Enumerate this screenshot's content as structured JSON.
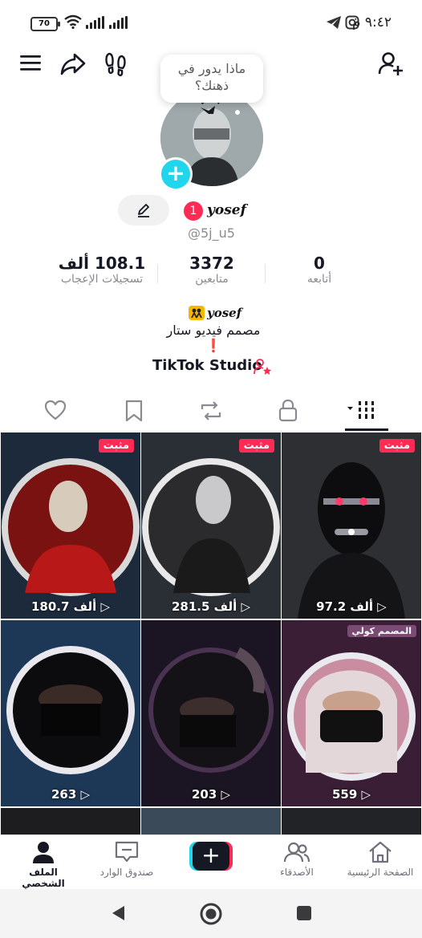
{
  "status_bar": {
    "battery": "70",
    "time": "٩:٤٢ م"
  },
  "bubble": {
    "line1": "ماذا يدور في",
    "line2": "ذهنك؟"
  },
  "profile": {
    "notification_count": "1",
    "display_name": "yosef",
    "handle": "@5j_u5"
  },
  "stats": [
    {
      "value": "0",
      "label": "أتابعه"
    },
    {
      "value": "3372",
      "label": "متابعين"
    },
    {
      "value": "108.1 ألف",
      "label": "تسجيلات الإعجاب"
    }
  ],
  "bio": {
    "name_line": "yosef",
    "text": "مصمم فيديو ستار ❗"
  },
  "studio": {
    "label": "TikTok Studio"
  },
  "videos": [
    {
      "pinned": "مثبت",
      "views": "180.7 ألف",
      "theme": "red"
    },
    {
      "pinned": "مثبت",
      "views": "281.5 ألف",
      "theme": "gray"
    },
    {
      "pinned": "مثبت",
      "views": "97.2 ألف",
      "theme": "dark"
    },
    {
      "pinned": "",
      "views": "263",
      "theme": "blue"
    },
    {
      "pinned": "",
      "views": "203",
      "theme": "purple"
    },
    {
      "pinned": "",
      "views": "559",
      "theme": "pink",
      "sticker": "المصمم كولي"
    }
  ],
  "bottom_nav": {
    "home": "الصفحة الرئيسية",
    "friends": "الأصدقاء",
    "inbox": "صندوق الوارد",
    "profile": "الملف الشخصي"
  },
  "colors": {
    "accent": "#fe2c55",
    "cyan": "#20d5ec",
    "text": "#161823",
    "muted": "#8a8b91"
  }
}
